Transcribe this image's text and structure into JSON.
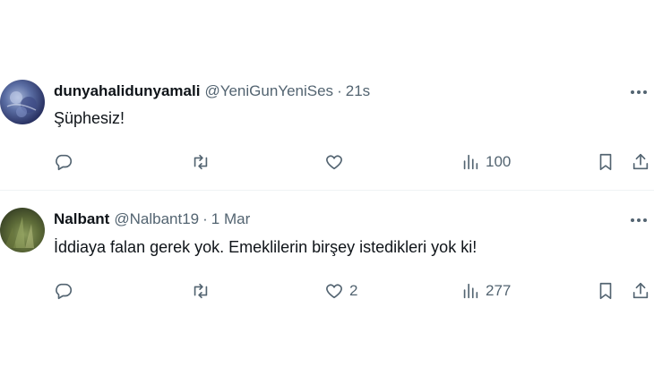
{
  "tweets": [
    {
      "name": "dunyahalidunyamali",
      "handle": "@YeniGunYeniSes",
      "separator": "·",
      "time": "21s",
      "text": "Şüphesiz!",
      "reply_count": "",
      "retweet_count": "",
      "like_count": "",
      "view_count": "100"
    },
    {
      "name": "Nalbant",
      "handle": "@Nalbant19",
      "separator": "·",
      "time": "1 Mar",
      "text": "İddiaya falan gerek yok. Emeklilerin birşey istedikleri yok ki!",
      "reply_count": "",
      "retweet_count": "",
      "like_count": "2",
      "view_count": "277"
    }
  ],
  "icons": {
    "more": "more-horizontal-icon",
    "reply": "reply-icon",
    "retweet": "retweet-icon",
    "like": "heart-icon",
    "views": "bar-chart-icon",
    "bookmark": "bookmark-icon",
    "share": "share-icon"
  },
  "colors": {
    "text_primary": "#0f1419",
    "text_secondary": "#536471",
    "divider": "#eff3f4",
    "background": "#ffffff"
  }
}
